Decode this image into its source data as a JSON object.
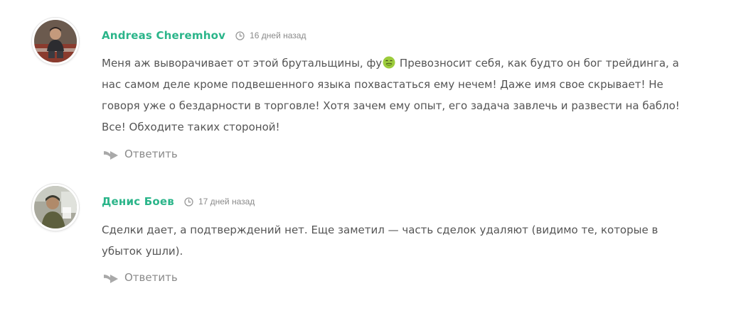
{
  "comments": [
    {
      "author": "Andreas Cheremhov",
      "time": "16 дней назад",
      "text_part1": "Меня аж выворачивает от этой брутальщины, фу",
      "emoji_icon": "nauseated-face-icon",
      "text_part2": " Превозносит себя, как будто он бог трейдинга, а нас самом деле кроме подвешенного языка похвастаться ему нечем! Даже имя свое скрывает! Не говоря уже о бездарности в торговле! Хотя зачем ему опыт, его задача завлечь и развести на бабло! Все! Обходите таких стороной!",
      "reply_label": "Ответить"
    },
    {
      "author": "Денис Боев",
      "time": "17 дней назад",
      "text": "Сделки дает, а подтверждений нет. Еще заметил — часть сделок удаляют (видимо те, которые в убыток ушли).",
      "reply_label": "Ответить"
    }
  ],
  "colors": {
    "author": "#2bb58a",
    "text": "#555555",
    "muted": "#8a8a8a"
  }
}
